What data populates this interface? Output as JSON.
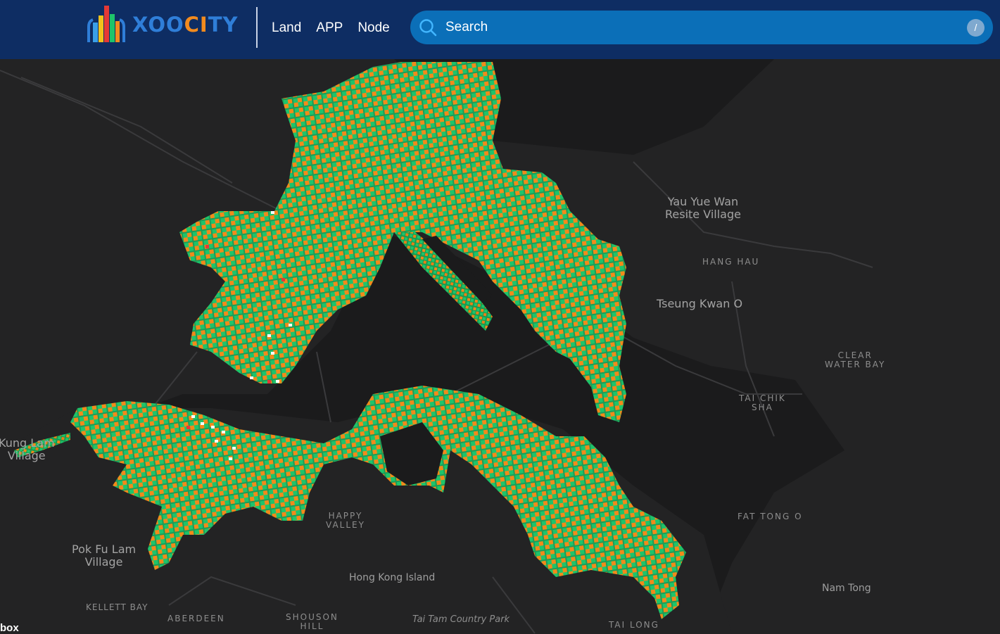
{
  "header": {
    "logo_part1": "XOO",
    "logo_part2": "CI",
    "logo_part3": "TY",
    "nav": [
      "Land",
      "APP",
      "Node"
    ],
    "search_placeholder": "Search",
    "search_value": "",
    "search_shortcut": "/"
  },
  "icons": {
    "search": "search-icon",
    "logo": "building-bars-logo"
  },
  "colors": {
    "header_bg": "#0e2d63",
    "search_bg": "#0b6fb8",
    "map_bg": "#1b1b1c",
    "parcel_green": "#1ec46a",
    "parcel_orange": "#f28a1a"
  },
  "map": {
    "labels": {
      "yau_yue_wan": "Yau Yue Wan\nResite Village",
      "hang_hau": "HANG HAU",
      "tseung_kwan_o": "Tseung Kwan O",
      "clear_water_bay": "CLEAR\nWATER BAY",
      "tai_chik_sha": "TAI CHIK\nSHA",
      "fat_tong_o": "FAT TONG O",
      "nam_tong": "Nam Tong",
      "kung_lam_village": "Kung Lam\nVillage",
      "pok_fu_lam": "Pok Fu Lam\nVillage",
      "happy_valley": "HAPPY\nVALLEY",
      "hong_kong_island": "Hong Kong Island",
      "kellett_bay": "KELLETT BAY",
      "aberdeen": "ABERDEEN",
      "shouson_hill": "SHOUSON\nHILL",
      "tai_tam": "Tai Tam Country Park",
      "tai_long": "TAI LONG"
    },
    "attribution": "box"
  }
}
